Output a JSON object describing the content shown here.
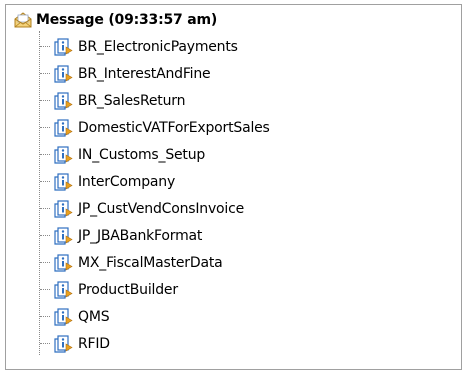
{
  "tree": {
    "root": {
      "label": "Message (09:33:57 am)",
      "icon": "envelope-open-icon"
    },
    "items": [
      {
        "label": "BR_ElectronicPayments",
        "icon": "object-info-icon"
      },
      {
        "label": "BR_InterestAndFine",
        "icon": "object-info-icon"
      },
      {
        "label": "BR_SalesReturn",
        "icon": "object-info-icon"
      },
      {
        "label": "DomesticVATForExportSales",
        "icon": "object-info-icon"
      },
      {
        "label": "IN_Customs_Setup",
        "icon": "object-info-icon"
      },
      {
        "label": "InterCompany",
        "icon": "object-info-icon"
      },
      {
        "label": "JP_CustVendConsInvoice",
        "icon": "object-info-icon"
      },
      {
        "label": "JP_JBABankFormat",
        "icon": "object-info-icon"
      },
      {
        "label": "MX_FiscalMasterData",
        "icon": "object-info-icon"
      },
      {
        "label": "ProductBuilder",
        "icon": "object-info-icon"
      },
      {
        "label": "QMS",
        "icon": "object-info-icon"
      },
      {
        "label": "RFID",
        "icon": "object-info-icon"
      }
    ]
  },
  "colors": {
    "border": "#a0a0a0",
    "tree_lines": "#8a8a8a",
    "icon_blue": "#2f6fc0",
    "icon_orange": "#e8a020"
  }
}
